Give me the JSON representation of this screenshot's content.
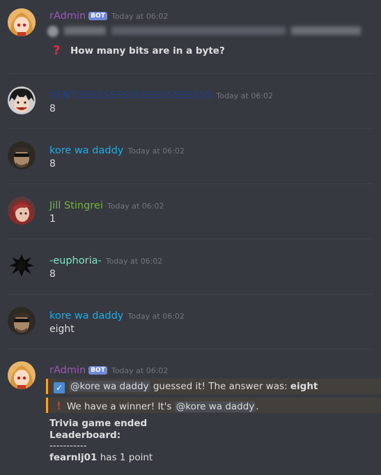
{
  "messages": [
    {
      "username": "rAdmin",
      "color": "#9b59b6",
      "bot": "BOT",
      "timestamp": "Today at 06:02",
      "question": "How many bits are in a byte?"
    },
    {
      "username": "VENTUSSSSSSSSSSSSSSSSSSSS",
      "color": "#1f3f8a",
      "timestamp": "Today at 06:02",
      "text": "8"
    },
    {
      "username": "kore wa daddy",
      "color": "#1aaee8",
      "timestamp": "Today at 06:02",
      "text": "8"
    },
    {
      "username": "Jill Stingrei",
      "color": "#71b83a",
      "timestamp": "Today at 06:02",
      "text": "1"
    },
    {
      "username": "-euphoria-",
      "color": "#7ee6c4",
      "timestamp": "Today at 06:02",
      "text": "8"
    },
    {
      "username": "kore wa daddy",
      "color": "#1aaee8",
      "timestamp": "Today at 06:02",
      "text": "eight"
    },
    {
      "username": "rAdmin",
      "color": "#9b59b6",
      "bot": "BOT",
      "timestamp": "Today at 06:02"
    }
  ],
  "result": {
    "mention": "@kore wa daddy",
    "guessed_text": " guessed it! The answer was: ",
    "answer": "eight",
    "winner_prefix": "We have a winner! It's ",
    "winner_mention": "@kore wa daddy",
    "winner_suffix": "."
  },
  "summary": {
    "ended": "Trivia game ended",
    "leaderboard": "Leaderboard:",
    "separator": "-----------",
    "player": "fearnlj01",
    "points": " has 1 point"
  },
  "icons": {
    "question": "red-question-mark-icon",
    "check": "checkmark-icon",
    "exclamation": "red-exclamation-icon"
  }
}
